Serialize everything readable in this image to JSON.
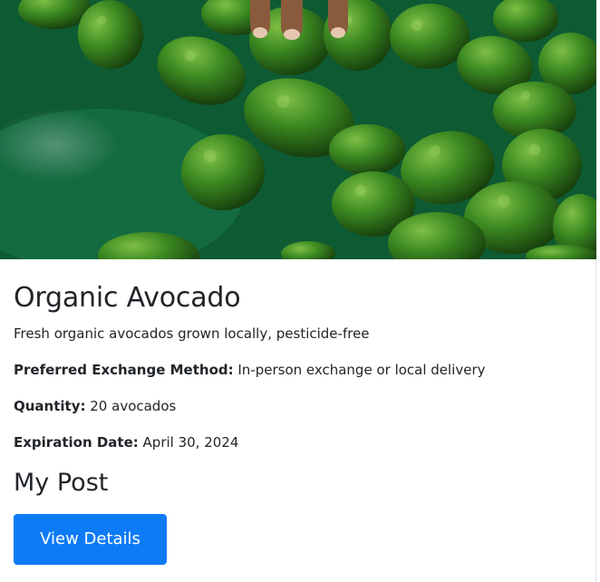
{
  "product": {
    "image_alt": "Green avocados on a sorting table",
    "name": "Organic Avocado",
    "description": "Fresh organic avocados grown locally, pesticide-free",
    "exchange_label": "Preferred Exchange Method:",
    "exchange_value": " In-person exchange or local delivery",
    "quantity_label": "Quantity:",
    "quantity_value": " 20 avocados",
    "expiration_label": "Expiration Date:",
    "expiration_value": " April 30, 2024"
  },
  "section": {
    "title": "My Post"
  },
  "actions": {
    "view_details_label": "View Details"
  },
  "colors": {
    "primary_button": "#0d7bf6",
    "image_background": "#0f5a33"
  }
}
